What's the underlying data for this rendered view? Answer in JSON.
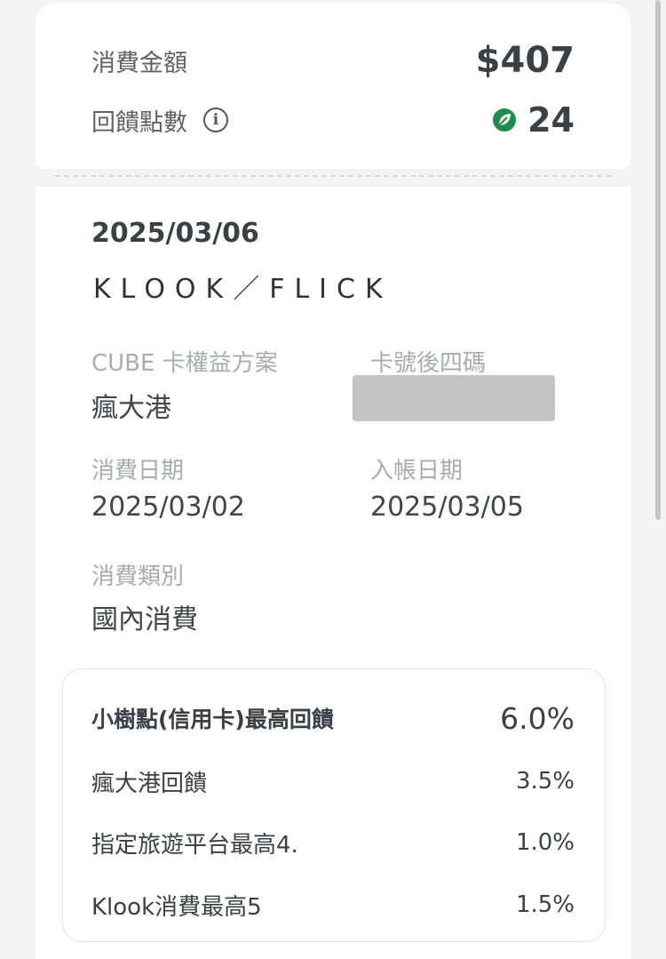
{
  "summary": {
    "amount_label": "消費金額",
    "amount_value": "$407",
    "points_label": "回饋點數",
    "points_value": "24"
  },
  "detail": {
    "posted_date": "2025/03/06",
    "merchant": "KLOOK／FLICK",
    "plan_label": "CUBE 卡權益方案",
    "plan_value": "瘋大港",
    "card_last4_label": "卡號後四碼",
    "spend_date_label": "消費日期",
    "spend_date_value": "2025/03/02",
    "post_date_label": "入帳日期",
    "post_date_value": "2025/03/05",
    "category_label": "消費類別",
    "category_value": "國內消費"
  },
  "rewards": {
    "title": "小樹點(信用卡)最高回饋",
    "total": "6.0%",
    "items": [
      {
        "label": "瘋大港回饋",
        "value": "3.5%"
      },
      {
        "label": "指定旅遊平台最高4.",
        "value": "1.0%"
      },
      {
        "label": "Klook消費最高5",
        "value": "1.5%"
      }
    ]
  },
  "colors": {
    "accent_green": "#1e8a4c",
    "text_dark": "#3a4146",
    "text_muted": "#a7acb0"
  },
  "icons": {
    "info": "info-icon",
    "points": "leaf-points-icon"
  }
}
